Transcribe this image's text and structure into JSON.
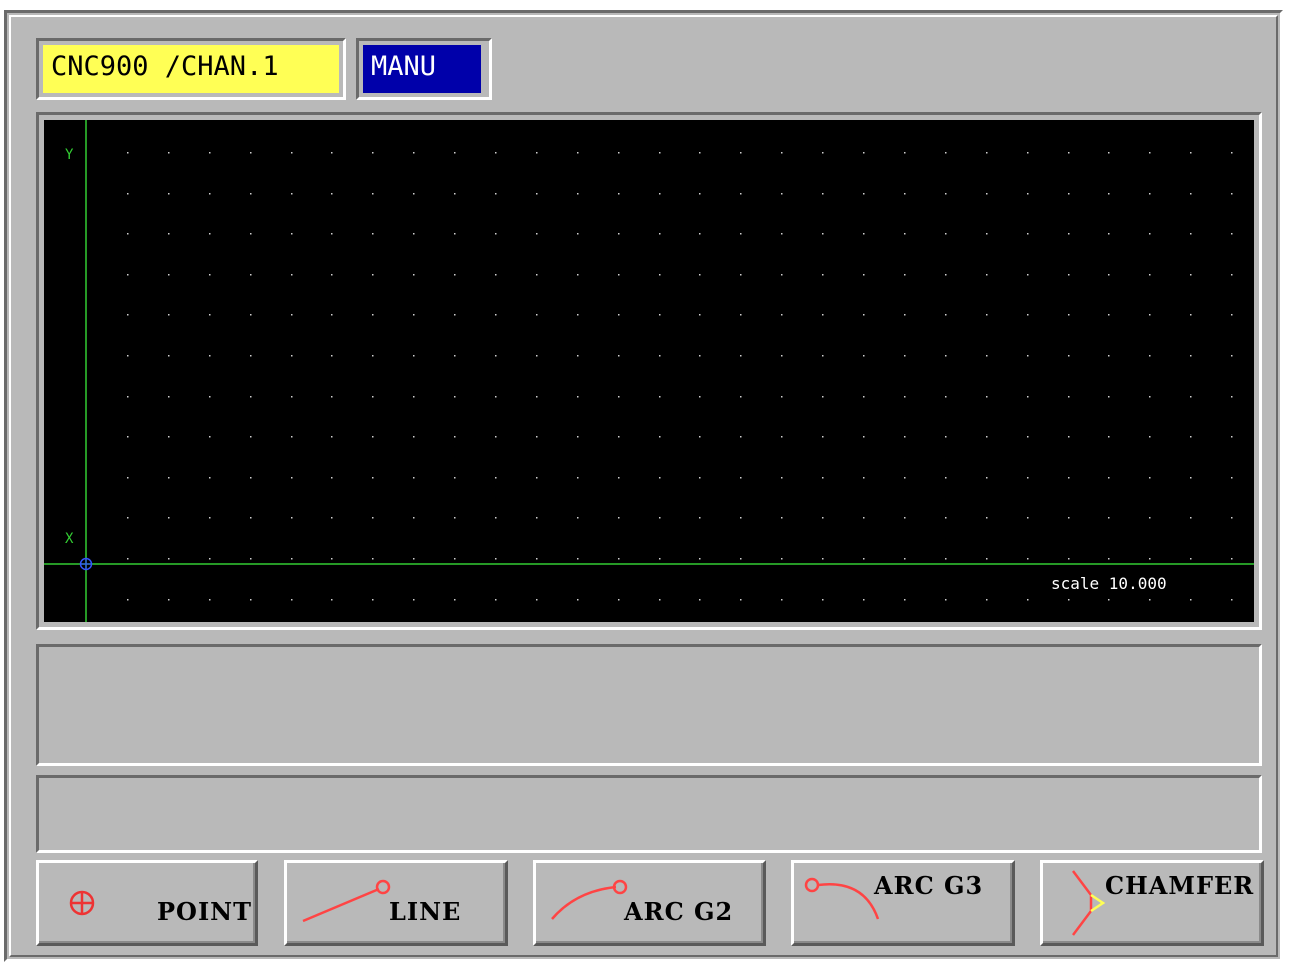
{
  "header": {
    "channel_label": "CNC900 /CHAN.1",
    "mode_label": "MANU"
  },
  "graphic": {
    "axis_y_label": "Y",
    "axis_x_label": "X",
    "scale_text": "scale 10.000"
  },
  "messages": {
    "line1": "",
    "line2": ""
  },
  "softkeys": [
    {
      "label": "POINT",
      "icon": "point-crosshair-icon"
    },
    {
      "label": "LINE",
      "icon": "line-segment-icon"
    },
    {
      "label": "ARC G2",
      "icon": "arc-clockwise-icon"
    },
    {
      "label": "ARC G3",
      "icon": "arc-counterclockwise-icon"
    },
    {
      "label": "CHAMFER",
      "icon": "chamfer-icon"
    }
  ],
  "colors": {
    "panel_gray": "#b9b9b9",
    "channel_bg": "#ffff55",
    "mode_bg": "#0000aa",
    "axis_green": "#33cc33",
    "icon_red": "#ff4444",
    "chamfer_yellow": "#ffff55"
  }
}
